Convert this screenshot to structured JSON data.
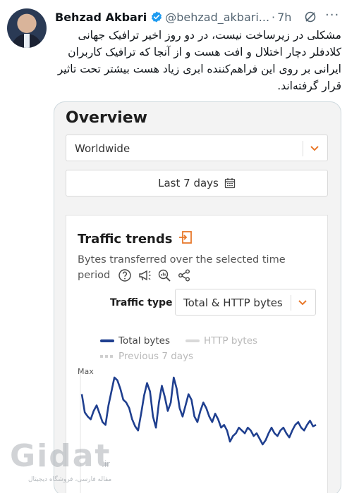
{
  "tweet": {
    "author_name": "Behzad Akbari",
    "handle": "@behzad_akbari...",
    "separator": "·",
    "time": "7h",
    "more_label": "···",
    "text": "مشکلی در زیرساخت نیست، در دو روز اخیر ترافیک جهانی کلادفلر دچار اختلال و افت هست و از آنجا که ترافیک کاربران ایرانی بر روی این فراهم‌کننده ابری زیاد هست بیشتر تحت تاثیر قرار گرفته‌اند.",
    "verified_color": "#1d9bf0"
  },
  "media": {
    "overview_title": "Overview",
    "region_select": "Worldwide",
    "date_range": "Last 7 days",
    "accent_color": "#e8792c",
    "trends": {
      "title": "Traffic trends",
      "description": "Bytes transferred over the selected time period",
      "traffic_type_label": "Traffic type",
      "traffic_type_value": "Total & HTTP bytes",
      "legend": {
        "total": "Total bytes",
        "http": "HTTP bytes",
        "previous": "Previous 7 days"
      },
      "max_label": "Max"
    }
  },
  "watermark": {
    "word": "Gidat",
    "tld": ".ir",
    "tagline": "مقاله فارسی، فروشگاه دیجیتال"
  },
  "chart_data": {
    "type": "line",
    "title": "Traffic trends",
    "ylabel": "",
    "xlabel": "",
    "ylim": [
      0,
      1
    ],
    "series": [
      {
        "name": "Total bytes",
        "color": "#1f3f8f",
        "x": [
          0,
          1,
          2,
          3,
          4,
          5,
          6,
          7,
          8,
          9,
          10,
          11,
          12,
          13,
          14,
          15,
          16,
          17,
          18,
          19,
          20,
          21,
          22,
          23,
          24,
          25,
          26,
          27,
          28,
          29,
          30,
          31,
          32,
          33,
          34,
          35,
          36,
          37,
          38,
          39,
          40,
          41,
          42,
          43,
          44,
          45,
          46,
          47,
          48,
          49,
          50,
          51,
          52,
          53,
          54,
          55,
          56,
          57,
          58,
          59,
          60,
          61,
          62,
          63,
          64,
          65,
          66,
          67,
          68,
          69,
          70,
          71,
          72,
          73,
          74,
          75,
          76,
          77,
          78,
          79
        ],
        "values": [
          0.86,
          0.73,
          0.7,
          0.68,
          0.74,
          0.78,
          0.72,
          0.66,
          0.64,
          0.78,
          0.88,
          0.98,
          0.96,
          0.9,
          0.82,
          0.8,
          0.76,
          0.68,
          0.63,
          0.6,
          0.72,
          0.85,
          0.94,
          0.88,
          0.7,
          0.62,
          0.8,
          0.92,
          0.84,
          0.74,
          0.8,
          0.98,
          0.9,
          0.76,
          0.7,
          0.78,
          0.86,
          0.82,
          0.7,
          0.66,
          0.74,
          0.8,
          0.76,
          0.7,
          0.66,
          0.72,
          0.68,
          0.62,
          0.64,
          0.6,
          0.52,
          0.56,
          0.58,
          0.62,
          0.6,
          0.58,
          0.62,
          0.6,
          0.56,
          0.58,
          0.54,
          0.5,
          0.53,
          0.58,
          0.62,
          0.58,
          0.56,
          0.6,
          0.62,
          0.58,
          0.55,
          0.6,
          0.64,
          0.66,
          0.62,
          0.6,
          0.64,
          0.67,
          0.63,
          0.64
        ]
      },
      {
        "name": "HTTP bytes",
        "color": "#d9d9d9",
        "values": []
      },
      {
        "name": "Previous 7 days",
        "color": "#cfcfcf",
        "values": []
      }
    ]
  }
}
